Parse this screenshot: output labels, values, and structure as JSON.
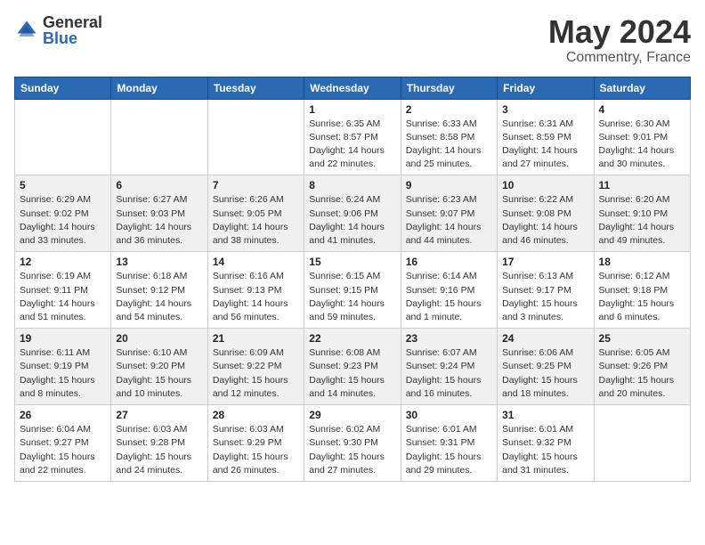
{
  "header": {
    "logo_general": "General",
    "logo_blue": "Blue",
    "title": "May 2024",
    "location": "Commentry, France"
  },
  "weekdays": [
    "Sunday",
    "Monday",
    "Tuesday",
    "Wednesday",
    "Thursday",
    "Friday",
    "Saturday"
  ],
  "weeks": [
    [
      {
        "day": "",
        "sunrise": "",
        "sunset": "",
        "daylight": ""
      },
      {
        "day": "",
        "sunrise": "",
        "sunset": "",
        "daylight": ""
      },
      {
        "day": "",
        "sunrise": "",
        "sunset": "",
        "daylight": ""
      },
      {
        "day": "1",
        "sunrise": "Sunrise: 6:35 AM",
        "sunset": "Sunset: 8:57 PM",
        "daylight": "Daylight: 14 hours and 22 minutes."
      },
      {
        "day": "2",
        "sunrise": "Sunrise: 6:33 AM",
        "sunset": "Sunset: 8:58 PM",
        "daylight": "Daylight: 14 hours and 25 minutes."
      },
      {
        "day": "3",
        "sunrise": "Sunrise: 6:31 AM",
        "sunset": "Sunset: 8:59 PM",
        "daylight": "Daylight: 14 hours and 27 minutes."
      },
      {
        "day": "4",
        "sunrise": "Sunrise: 6:30 AM",
        "sunset": "Sunset: 9:01 PM",
        "daylight": "Daylight: 14 hours and 30 minutes."
      }
    ],
    [
      {
        "day": "5",
        "sunrise": "Sunrise: 6:29 AM",
        "sunset": "Sunset: 9:02 PM",
        "daylight": "Daylight: 14 hours and 33 minutes."
      },
      {
        "day": "6",
        "sunrise": "Sunrise: 6:27 AM",
        "sunset": "Sunset: 9:03 PM",
        "daylight": "Daylight: 14 hours and 36 minutes."
      },
      {
        "day": "7",
        "sunrise": "Sunrise: 6:26 AM",
        "sunset": "Sunset: 9:05 PM",
        "daylight": "Daylight: 14 hours and 38 minutes."
      },
      {
        "day": "8",
        "sunrise": "Sunrise: 6:24 AM",
        "sunset": "Sunset: 9:06 PM",
        "daylight": "Daylight: 14 hours and 41 minutes."
      },
      {
        "day": "9",
        "sunrise": "Sunrise: 6:23 AM",
        "sunset": "Sunset: 9:07 PM",
        "daylight": "Daylight: 14 hours and 44 minutes."
      },
      {
        "day": "10",
        "sunrise": "Sunrise: 6:22 AM",
        "sunset": "Sunset: 9:08 PM",
        "daylight": "Daylight: 14 hours and 46 minutes."
      },
      {
        "day": "11",
        "sunrise": "Sunrise: 6:20 AM",
        "sunset": "Sunset: 9:10 PM",
        "daylight": "Daylight: 14 hours and 49 minutes."
      }
    ],
    [
      {
        "day": "12",
        "sunrise": "Sunrise: 6:19 AM",
        "sunset": "Sunset: 9:11 PM",
        "daylight": "Daylight: 14 hours and 51 minutes."
      },
      {
        "day": "13",
        "sunrise": "Sunrise: 6:18 AM",
        "sunset": "Sunset: 9:12 PM",
        "daylight": "Daylight: 14 hours and 54 minutes."
      },
      {
        "day": "14",
        "sunrise": "Sunrise: 6:16 AM",
        "sunset": "Sunset: 9:13 PM",
        "daylight": "Daylight: 14 hours and 56 minutes."
      },
      {
        "day": "15",
        "sunrise": "Sunrise: 6:15 AM",
        "sunset": "Sunset: 9:15 PM",
        "daylight": "Daylight: 14 hours and 59 minutes."
      },
      {
        "day": "16",
        "sunrise": "Sunrise: 6:14 AM",
        "sunset": "Sunset: 9:16 PM",
        "daylight": "Daylight: 15 hours and 1 minute."
      },
      {
        "day": "17",
        "sunrise": "Sunrise: 6:13 AM",
        "sunset": "Sunset: 9:17 PM",
        "daylight": "Daylight: 15 hours and 3 minutes."
      },
      {
        "day": "18",
        "sunrise": "Sunrise: 6:12 AM",
        "sunset": "Sunset: 9:18 PM",
        "daylight": "Daylight: 15 hours and 6 minutes."
      }
    ],
    [
      {
        "day": "19",
        "sunrise": "Sunrise: 6:11 AM",
        "sunset": "Sunset: 9:19 PM",
        "daylight": "Daylight: 15 hours and 8 minutes."
      },
      {
        "day": "20",
        "sunrise": "Sunrise: 6:10 AM",
        "sunset": "Sunset: 9:20 PM",
        "daylight": "Daylight: 15 hours and 10 minutes."
      },
      {
        "day": "21",
        "sunrise": "Sunrise: 6:09 AM",
        "sunset": "Sunset: 9:22 PM",
        "daylight": "Daylight: 15 hours and 12 minutes."
      },
      {
        "day": "22",
        "sunrise": "Sunrise: 6:08 AM",
        "sunset": "Sunset: 9:23 PM",
        "daylight": "Daylight: 15 hours and 14 minutes."
      },
      {
        "day": "23",
        "sunrise": "Sunrise: 6:07 AM",
        "sunset": "Sunset: 9:24 PM",
        "daylight": "Daylight: 15 hours and 16 minutes."
      },
      {
        "day": "24",
        "sunrise": "Sunrise: 6:06 AM",
        "sunset": "Sunset: 9:25 PM",
        "daylight": "Daylight: 15 hours and 18 minutes."
      },
      {
        "day": "25",
        "sunrise": "Sunrise: 6:05 AM",
        "sunset": "Sunset: 9:26 PM",
        "daylight": "Daylight: 15 hours and 20 minutes."
      }
    ],
    [
      {
        "day": "26",
        "sunrise": "Sunrise: 6:04 AM",
        "sunset": "Sunset: 9:27 PM",
        "daylight": "Daylight: 15 hours and 22 minutes."
      },
      {
        "day": "27",
        "sunrise": "Sunrise: 6:03 AM",
        "sunset": "Sunset: 9:28 PM",
        "daylight": "Daylight: 15 hours and 24 minutes."
      },
      {
        "day": "28",
        "sunrise": "Sunrise: 6:03 AM",
        "sunset": "Sunset: 9:29 PM",
        "daylight": "Daylight: 15 hours and 26 minutes."
      },
      {
        "day": "29",
        "sunrise": "Sunrise: 6:02 AM",
        "sunset": "Sunset: 9:30 PM",
        "daylight": "Daylight: 15 hours and 27 minutes."
      },
      {
        "day": "30",
        "sunrise": "Sunrise: 6:01 AM",
        "sunset": "Sunset: 9:31 PM",
        "daylight": "Daylight: 15 hours and 29 minutes."
      },
      {
        "day": "31",
        "sunrise": "Sunrise: 6:01 AM",
        "sunset": "Sunset: 9:32 PM",
        "daylight": "Daylight: 15 hours and 31 minutes."
      },
      {
        "day": "",
        "sunrise": "",
        "sunset": "",
        "daylight": ""
      }
    ]
  ]
}
